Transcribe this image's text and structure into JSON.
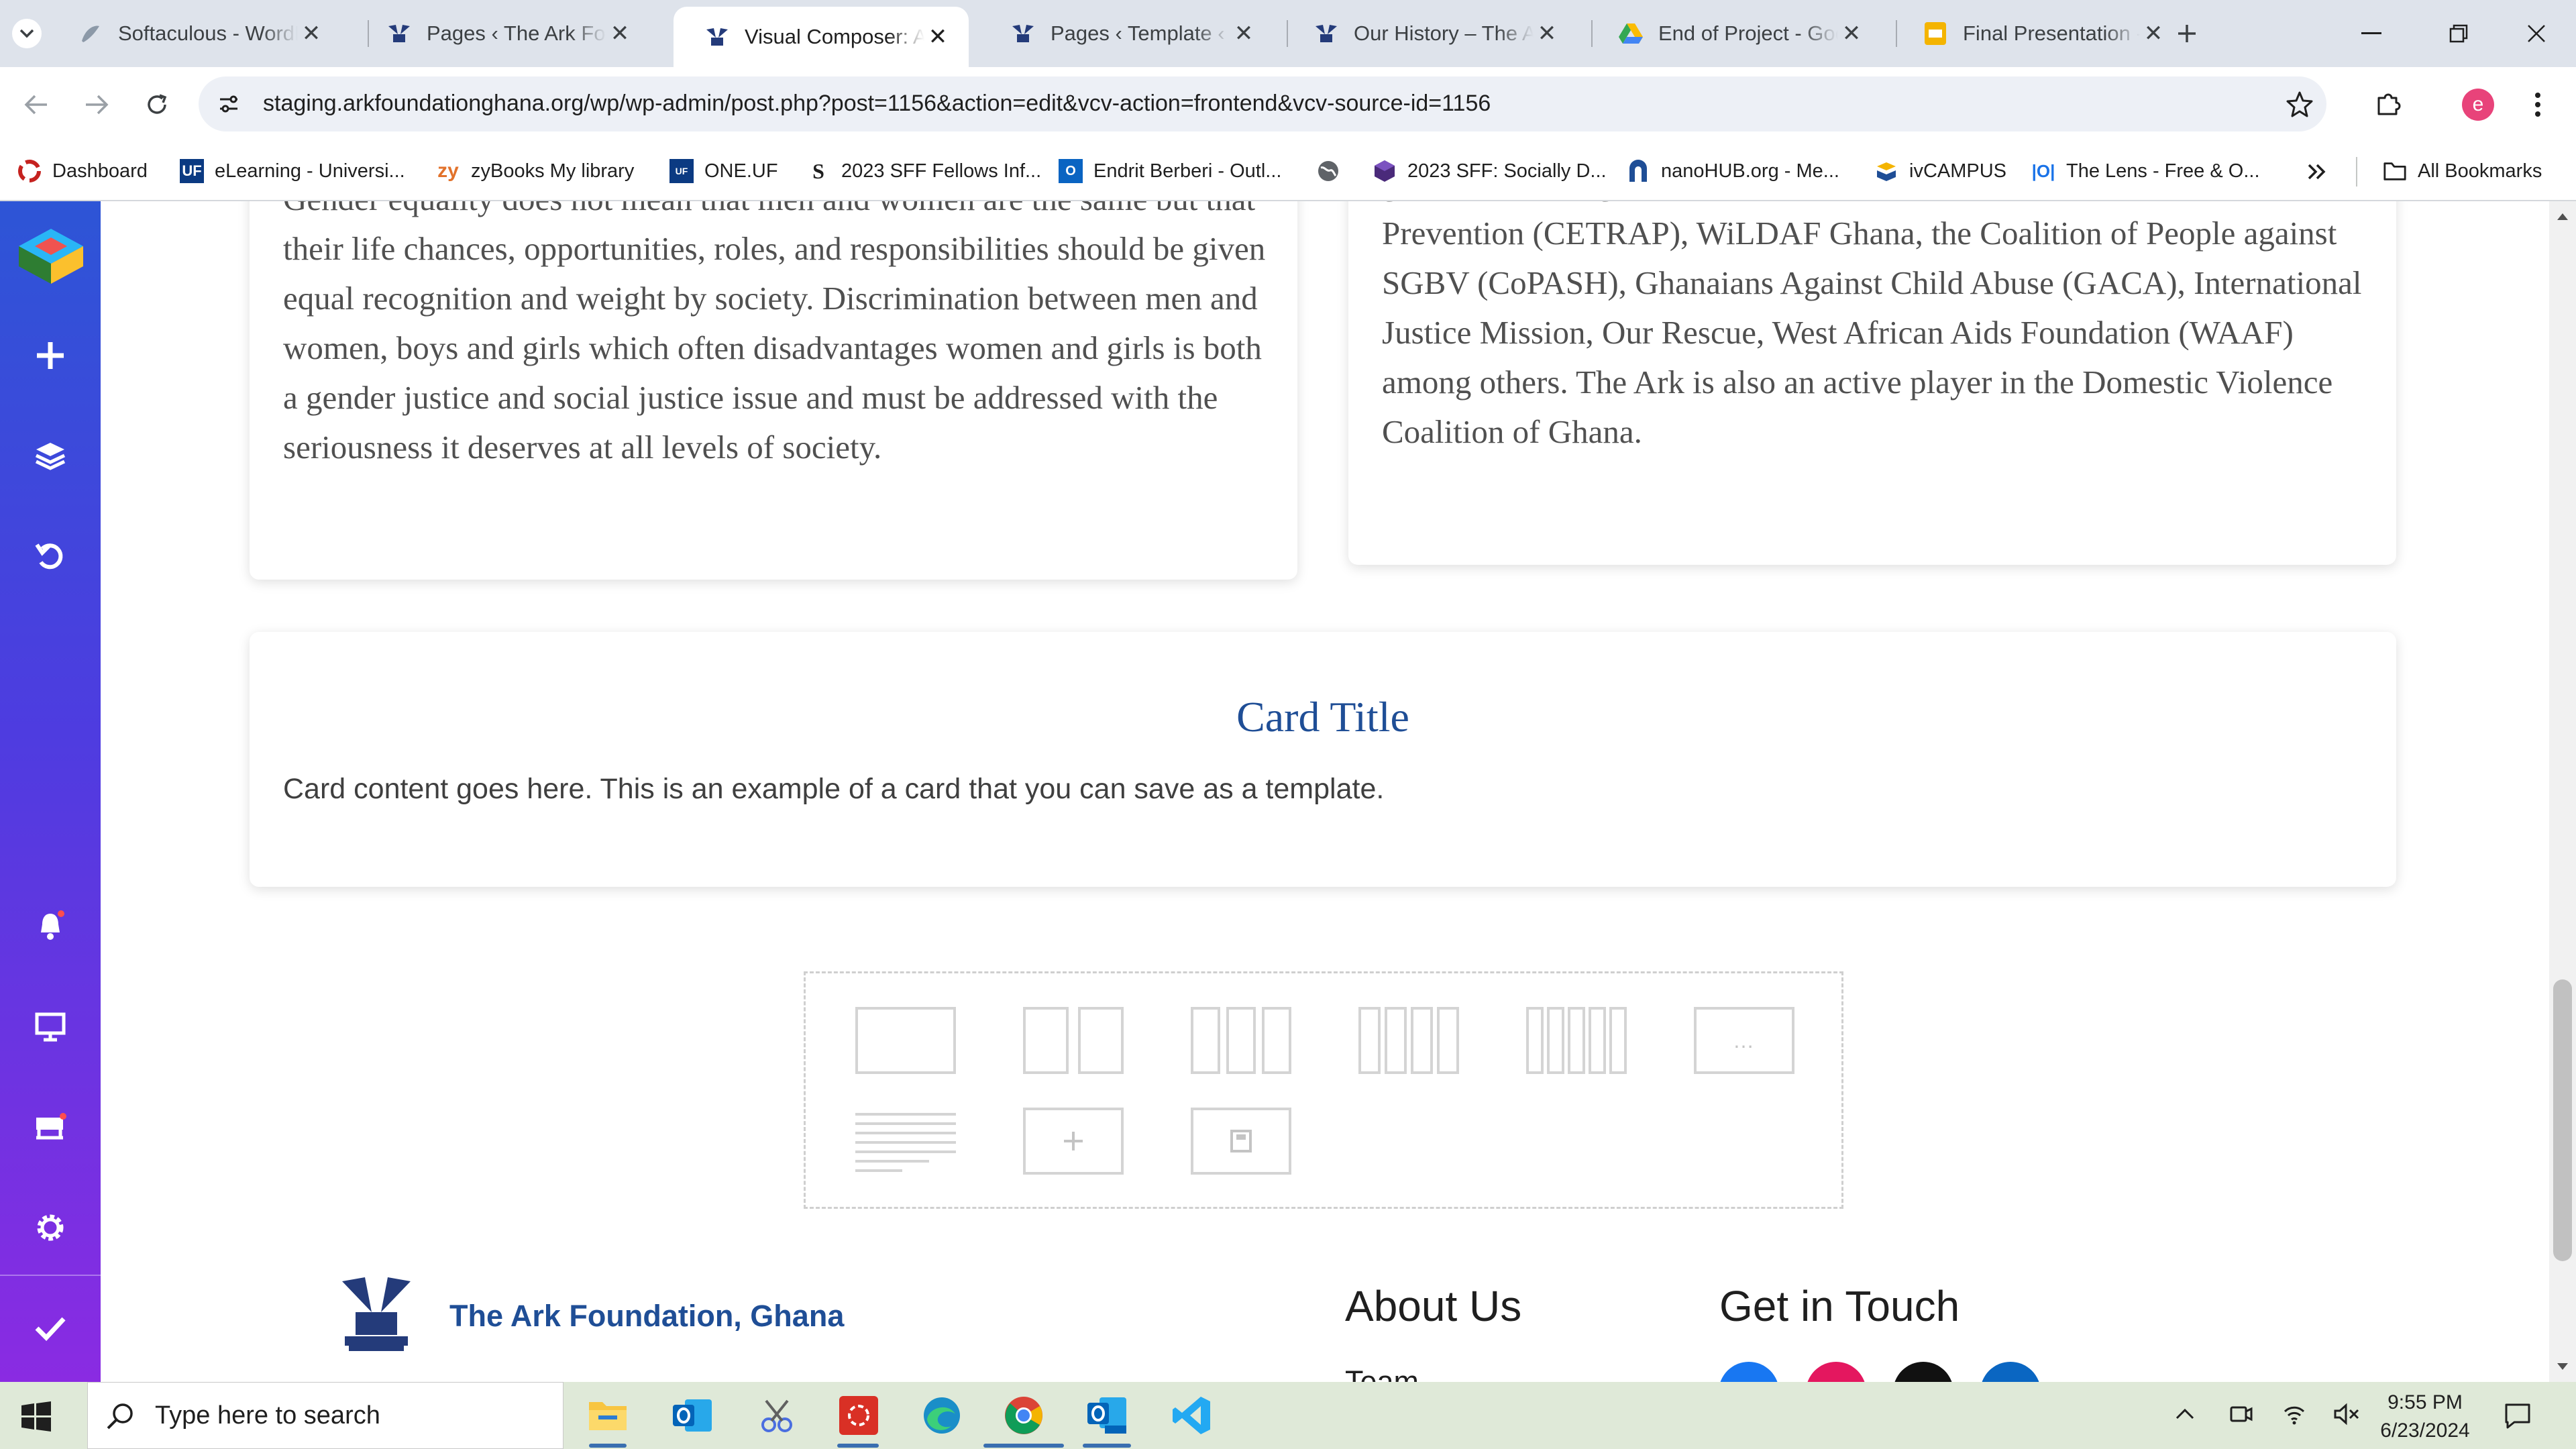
{
  "tabs": [
    {
      "title": "Softaculous - WordPr",
      "favicon": "softaculous-icon"
    },
    {
      "title": "Pages ‹ The Ark Foun",
      "favicon": "ark-icon"
    },
    {
      "title": "Visual Composer: Ab",
      "favicon": "ark-icon",
      "active": true
    },
    {
      "title": "Pages ‹ Template ‹ Th",
      "favicon": "ark-icon"
    },
    {
      "title": "Our History – The Ar",
      "favicon": "ark-icon"
    },
    {
      "title": "End of Project - Goo",
      "favicon": "google-drive-icon"
    },
    {
      "title": "Final Presentation - ",
      "favicon": "google-slides-icon"
    }
  ],
  "url": "staging.arkfoundationghana.org/wp/wp-admin/post.php?post=1156&action=edit&vcv-action=frontend&vcv-source-id=1156",
  "profile_initial": "e",
  "bookmarks": [
    {
      "label": "Dashboard"
    },
    {
      "label": "eLearning - Universi..."
    },
    {
      "label": "zyBooks My library"
    },
    {
      "label": "ONE.UF"
    },
    {
      "label": "2023 SFF Fellows Inf..."
    },
    {
      "label": "Endrit Berberi - Outl..."
    },
    {
      "label": ""
    },
    {
      "label": "2023 SFF: Socially D..."
    },
    {
      "label": "nanoHUB.org - Me..."
    },
    {
      "label": "ivCAMPUS"
    },
    {
      "label": "The Lens - Free & O..."
    }
  ],
  "bookmarks_all": "All Bookmarks",
  "left_card_text": "Gender equality does not mean that men and women are the same but that their life chances, opportunities, roles, and responsibilities should be given equal recognition and weight by society. Discrimination between men and women, boys and girls which often disadvantages women and girls is both a gender justice and social justice issue and must be addressed with the seriousness it deserves at all levels of society.",
  "right_card_text": "governmental organizations such as the Centre for Trauma Relief and Prevention (CETRAP), WiLDAF Ghana, the Coalition of People against SGBV (CoPASH), Ghanaians Against Child Abuse (GACA), International Justice Mission, Our Rescue, West African Aids Foundation (WAAF) among others. The Ark is also an active player in the Domestic Violence Coalition of Ghana.",
  "card": {
    "title": "Card Title",
    "content": "Card content goes here. This is an example of a card that you can save as a template."
  },
  "footer": {
    "brand": "The Ark Foundation, Ghana",
    "about_heading": "About Us",
    "contact_heading": "Get in Touch",
    "about_first_link": "Team"
  },
  "taskbar": {
    "search_placeholder": "Type here to search",
    "time": "9:55 PM",
    "date": "6/23/2024"
  },
  "colors": {
    "accent_blue": "#1f4e96",
    "sidebar_top": "#2d55d6",
    "sidebar_bottom": "#8a2be2",
    "profile": "#e8437a"
  }
}
